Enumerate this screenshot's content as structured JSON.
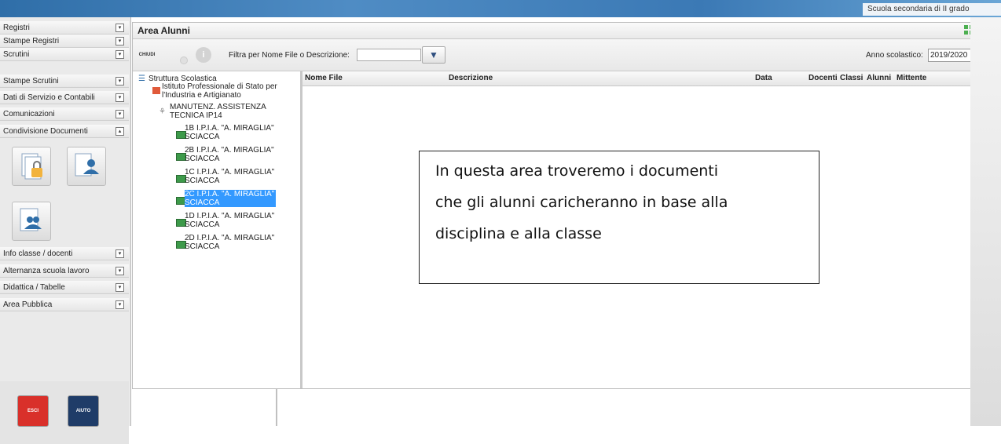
{
  "header": {
    "school_type": "Scuola secondaria di II grado"
  },
  "sidebar": {
    "items": [
      {
        "label": "Registri"
      },
      {
        "label": "Stampe Registri"
      },
      {
        "label": "Scrutini"
      },
      {
        "label": "Stampe Scrutini"
      },
      {
        "label": "Dati di Servizio e Contabili"
      },
      {
        "label": "Comunicazioni"
      },
      {
        "label": "Condivisione Documenti"
      }
    ],
    "items2": [
      {
        "label": "Info classe / docenti"
      },
      {
        "label": "Alternanza scuola lavoro"
      },
      {
        "label": "Didattica / Tabelle"
      },
      {
        "label": "Area Pubblica"
      }
    ],
    "exit_label": "ESCI",
    "help_label": "AIUTO"
  },
  "panel": {
    "title": "Area Alunni",
    "close_label": "CHIUDI",
    "filter_label": "Filtra per Nome File o Descrizione:",
    "filter_value": "",
    "year_label": "Anno scolastico:",
    "year_value": "2019/2020"
  },
  "tree": {
    "root": "Struttura Scolastica",
    "institute_line1": "Istituto Professionale di Stato per",
    "institute_line2": "l'Industria e Artigianato",
    "course_line1": "MANUTENZ. ASSISTENZA",
    "course_line2": "TECNICA IP14",
    "classes": [
      {
        "line1": "1B I.P.I.A. \"A. MIRAGLIA\"",
        "line2": "SCIACCA",
        "selected": false
      },
      {
        "line1": "2B I.P.I.A. \"A. MIRAGLIA\"",
        "line2": "SCIACCA",
        "selected": false
      },
      {
        "line1": "1C I.P.I.A. \"A. MIRAGLIA\"",
        "line2": "SCIACCA",
        "selected": false
      },
      {
        "line1": "2C I.P.I.A. \"A. MIRAGLIA\"",
        "line2": "SCIACCA",
        "selected": true
      },
      {
        "line1": "1D I.P.I.A. \"A. MIRAGLIA\"",
        "line2": "SCIACCA",
        "selected": false
      },
      {
        "line1": "2D I.P.I.A. \"A. MIRAGLIA\"",
        "line2": "SCIACCA",
        "selected": false
      }
    ]
  },
  "grid": {
    "columns": [
      "Nome File",
      "Descrizione",
      "Data",
      "Docenti",
      "Classi",
      "Alunni",
      "Mittente"
    ]
  },
  "note": {
    "lines": [
      "In questa area troveremo i documenti",
      "che gli alunni caricheranno in base alla",
      "disciplina e alla classe"
    ]
  },
  "colors": {
    "accent_blue": "#3b79b5",
    "selected_bg": "#3399ff",
    "exit_red": "#d9302a",
    "help_navy": "#1f3c68"
  }
}
